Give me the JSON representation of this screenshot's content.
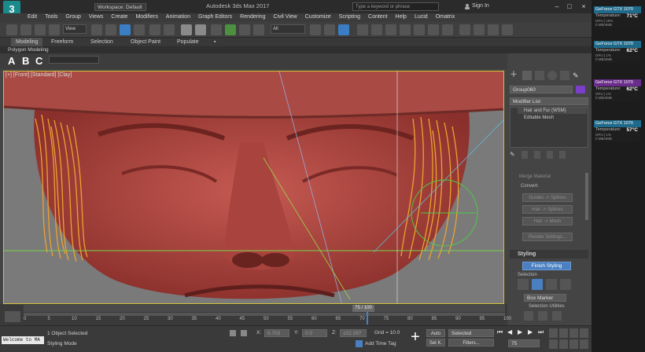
{
  "app": {
    "logo": "3"
  },
  "title": {
    "workspace": "Workspace: Default",
    "window_title": "Autodesk 3ds Max 2017",
    "search_placeholder": "Type a keyword or phrase",
    "sign_in": "Sign In"
  },
  "menu": [
    "Edit",
    "Tools",
    "Group",
    "Views",
    "Create",
    "Modifiers",
    "Animation",
    "Graph Editors",
    "Rendering",
    "Civil View",
    "Customize",
    "Scripting",
    "Content",
    "Help",
    "Lucid",
    "Omatrix"
  ],
  "toolbar": {
    "view_dropdown": "View",
    "selection_set": "All"
  },
  "ribbon": {
    "tabs": [
      "Modeling",
      "Freeform",
      "Selection",
      "Object Paint",
      "Populate"
    ],
    "poly_label": "Polygon Modeling"
  },
  "abc": {
    "a": "A",
    "b": "B",
    "c": "C"
  },
  "viewport": {
    "label": "[+] [Front] [Standard] [Clay]"
  },
  "command_panel": {
    "object_name": "Group060",
    "modifier_list": "Modifier List",
    "stack": [
      "Hair and Fur (WSM)",
      "Editable Mesh"
    ],
    "merge_material": "Merge Material",
    "convert_label": "Convert:",
    "guides_to_splines": "Guides -> Splines",
    "hair_to_splines": "Hair -> Splines",
    "hair_to_mesh": "Hair -> Mesh",
    "render_settings": "Render Settings...",
    "styling_header": "Styling",
    "finish_styling": "Finish Styling",
    "selection_label": "Selection",
    "box_marker": "Box Marker",
    "selection_utilities": "Selection Utilities"
  },
  "timeline": {
    "frame_indicator": "75 / 100",
    "ticks": [
      "0",
      "5",
      "10",
      "15",
      "20",
      "25",
      "30",
      "35",
      "40",
      "45",
      "50",
      "55",
      "60",
      "65",
      "70",
      "75",
      "80",
      "85",
      "90",
      "95",
      "100"
    ]
  },
  "status": {
    "maxscript": "Welcome to MA",
    "selected": "1 Object Selected",
    "mode": "Styling Mode",
    "x_label": "X:",
    "x_value": "0.703",
    "y_label": "Y:",
    "y_value": "0.0",
    "z_label": "Z:",
    "z_value": "102.297",
    "grid": "Grid = 10.0",
    "add_time_tag": "Add Time Tag",
    "auto": "Auto",
    "set_k": "Set K.",
    "selected_dropdown": "Selected",
    "filters": "Filters...",
    "frame_value": "75"
  },
  "gpu_monitor": [
    {
      "name": "GeForce GTX 1070",
      "temp_label": "Temperature:",
      "temp": "71°C",
      "gpu": "GPU | 19%",
      "mem": "0 MB/4MB",
      "color": "#1f6a8a"
    },
    {
      "name": "GeForce GTX 1070",
      "temp_label": "Temperature:",
      "temp": "62°C",
      "gpu": "GPU | 1%",
      "mem": "0 MB/4MB",
      "color": "#1f6a8a"
    },
    {
      "name": "GeForce GTX 1070",
      "temp_label": "Temperature:",
      "temp": "62°C",
      "gpu": "GPU | 1%",
      "mem": "0 MB/4MB",
      "color": "#6a2c8a"
    },
    {
      "name": "GeForce GTX 1070",
      "temp_label": "Temperature:",
      "temp": "57°C",
      "gpu": "GPU | 1%",
      "mem": "0 MB/4MB",
      "color": "#1f6a8a"
    }
  ],
  "colors": {
    "accent": "#4a7fc1",
    "viewport_border": "#d2c13a",
    "hair": "#f0a030",
    "skin": "#b24a44"
  }
}
